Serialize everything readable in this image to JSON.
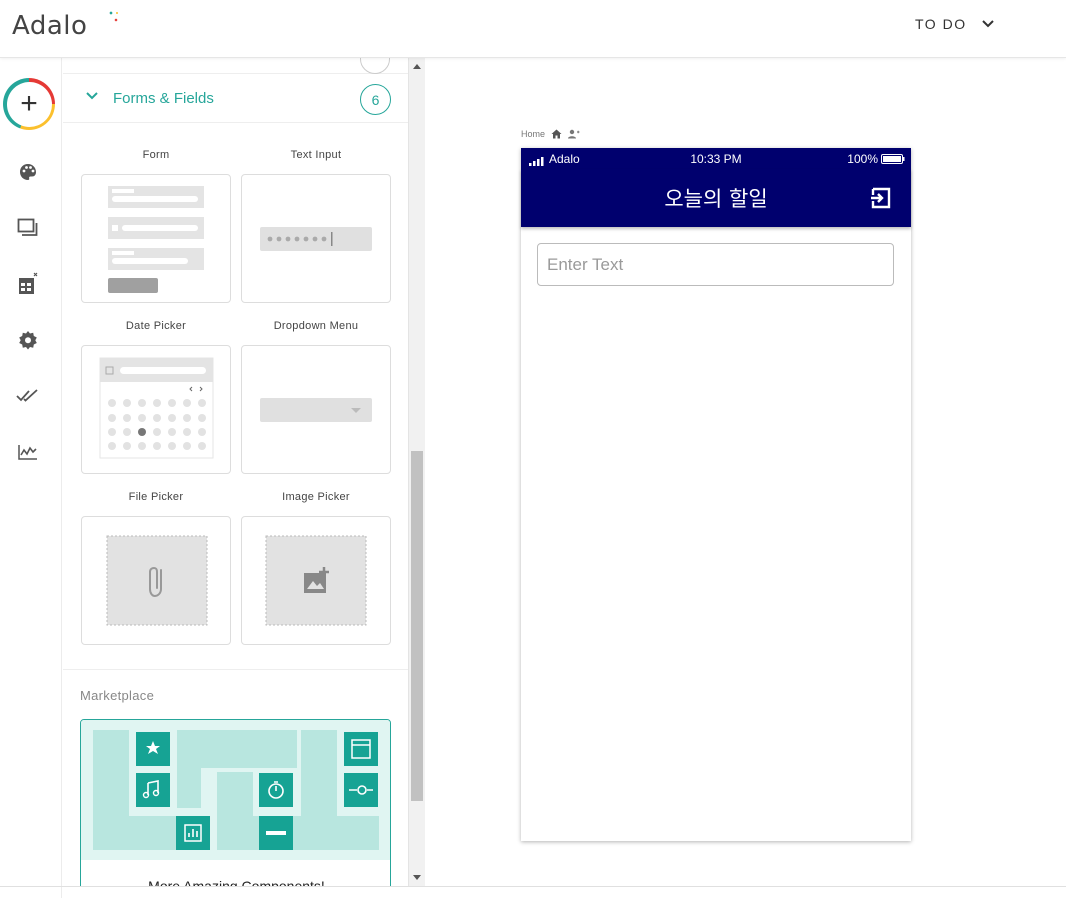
{
  "topbar": {
    "logo_text": "Adalo",
    "app_name": "TO DO"
  },
  "rail": {
    "add_label": "+"
  },
  "panel": {
    "section": {
      "title": "Forms & Fields",
      "count": "6"
    },
    "components": [
      {
        "label": "Form"
      },
      {
        "label": "Text Input"
      },
      {
        "label": "Date Picker"
      },
      {
        "label": "Dropdown Menu"
      },
      {
        "label": "File Picker"
      },
      {
        "label": "Image Picker"
      }
    ],
    "marketplace": {
      "label": "Marketplace",
      "card_title": "More Amazing Components!"
    }
  },
  "canvas": {
    "screen_name": "Home",
    "statusbar": {
      "carrier": "Adalo",
      "time": "10:33 PM",
      "battery": "100%"
    },
    "appbar": {
      "title": "오늘의 할일"
    },
    "input": {
      "placeholder": "Enter Text"
    }
  },
  "colors": {
    "accent": "#26a69a",
    "appbar": "#00006e",
    "logo_sparkle": "#26a69a"
  }
}
